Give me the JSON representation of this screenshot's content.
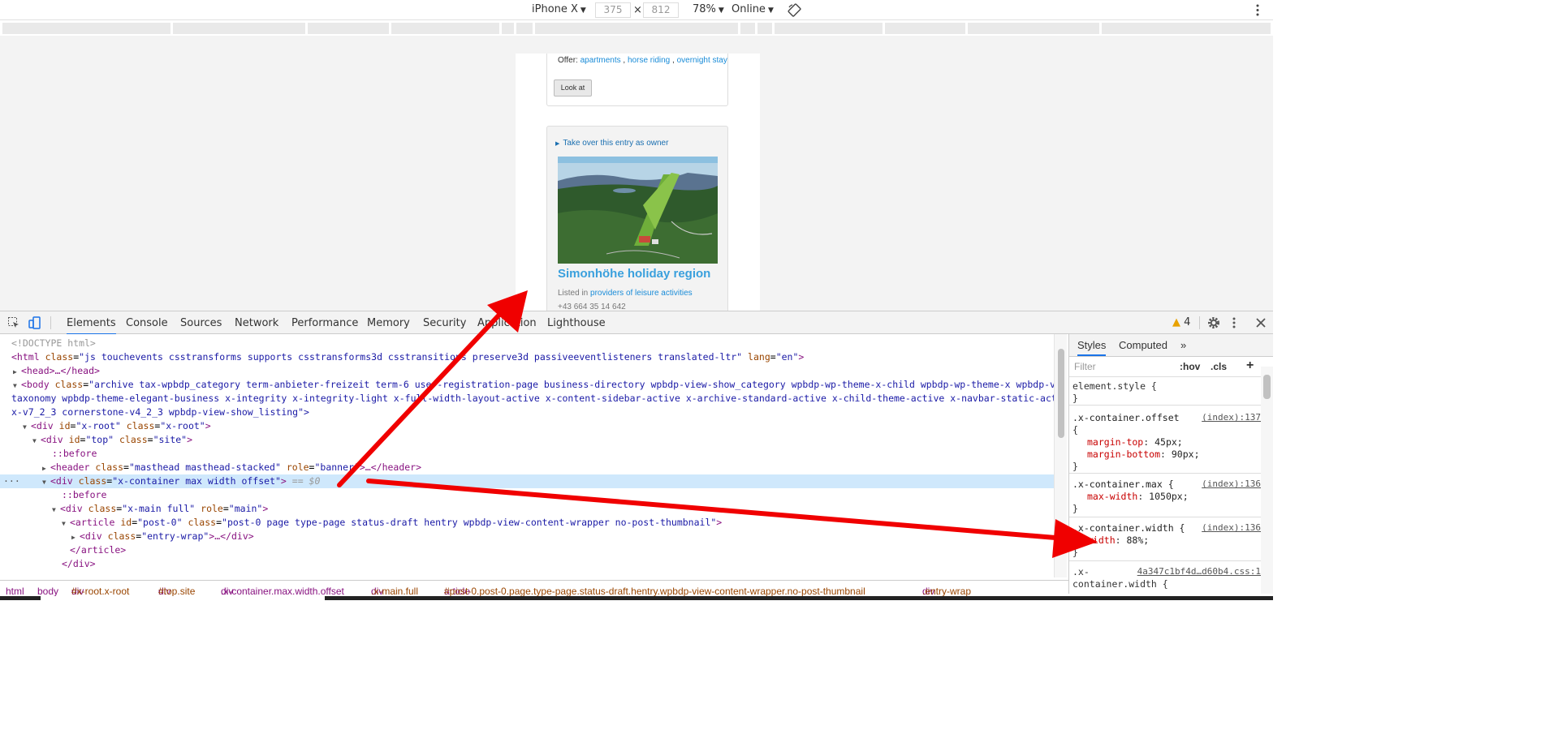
{
  "device_toolbar": {
    "device": "iPhone X",
    "width": "375",
    "times": "×",
    "height": "812",
    "zoom": "78%",
    "network": "Online",
    "rotate_icon": "rotate-icon",
    "more_icon": "vertical-dots-icon"
  },
  "page": {
    "offer_label": "Offer:",
    "offer_links": [
      "apartments",
      "horse riding",
      "overnight stay"
    ],
    "offer_sep": ",",
    "look_at": "Look at",
    "takeover": "Take over this entry as owner",
    "listing_title": "Simonhöhe holiday region",
    "listed_in": "Listed in",
    "listed_link": "providers of leisure activities",
    "phone": "+43 664 35 14 642"
  },
  "devtools": {
    "tabs": [
      "Elements",
      "Console",
      "Sources",
      "Network",
      "Performance",
      "Memory",
      "Security",
      "Application",
      "Lighthouse"
    ],
    "active_tab": "Elements",
    "warnings": "4",
    "styles_tabs": [
      "Styles",
      "Computed"
    ],
    "more_tabs": "»",
    "filter_placeholder": "Filter",
    "hov": ":hov",
    "cls": ".cls",
    "plus": "+"
  },
  "dom": {
    "doctype": "<!DOCTYPE html>",
    "html_tag": "<html",
    "html_class_attr": "class",
    "html_class": "\"js touchevents csstransforms supports csstransforms3d csstransitions preserve3d passiveeventlisteners translated-ltr\"",
    "html_lang_attr": "lang",
    "html_lang": "\"en\"",
    "head": "<head>…</head>",
    "body_tag": "<body",
    "body_class_attr": "class",
    "body_class_1": "\"archive tax-wpbdp_category term-anbieter-freizeit term-6 user-registration-page business-directory wpbdp-view-show_category wpbdp-wp-theme-x-child wpbdp-wp-theme-x wpbdp-view-",
    "body_class_2": "taxonomy wpbdp-theme-elegant-business x-integrity x-integrity-light x-full-width-layout-active x-content-sidebar-active x-archive-standard-active x-child-theme-active x-navbar-static-active",
    "body_class_3": "x-v7_2_3 cornerstone-v4_2_3 wpbdp-view-show_listing\">",
    "xroot_open": "<div",
    "xroot_id": "\"x-root\"",
    "xroot_class": "\"x-root\"",
    "top_id": "\"top\"",
    "top_class": "\"site\"",
    "before": "::before",
    "header_class": "\"masthead masthead-stacked\"",
    "header_role": "\"banner\"",
    "header_rest": ">…</header>",
    "container_class": "\"x-container max width offset\"",
    "eq_dollar": " == $0",
    "main_class": "\"x-main full\"",
    "main_role": "\"main\"",
    "article_id": "\"post-0\"",
    "article_class": "\"post-0 page type-page status-draft hentry wpbdp-view-content-wrapper no-post-thumbnail\"",
    "entry_wrap_class": "\"entry-wrap\"",
    "entry_rest": ">…</div>",
    "article_close": "</article>",
    "div_close": "</div>",
    "dots": "···"
  },
  "styles": {
    "element_style": "element.style {",
    "close": "}",
    "rules": [
      {
        "selector": ".x-container.offset",
        "source": "(index):137",
        "brace": "{",
        "props": [
          {
            "name": "margin-top",
            "value": "45px;"
          },
          {
            "name": "margin-bottom",
            "value": "90px;"
          }
        ]
      },
      {
        "selector": ".x-container.max {",
        "source": "(index):136",
        "props": [
          {
            "name": "max-width",
            "value": "1050px;"
          }
        ]
      },
      {
        "selector": ".x-container.width {",
        "source": "(index):136",
        "props": [
          {
            "name": "width",
            "value": "88%;"
          }
        ]
      }
    ],
    "last_selector_1": ".x-",
    "last_selector_2": "container.width {",
    "last_source": "4a347c1bf4d…d60b4.css:1"
  },
  "breadcrumb": [
    {
      "tag": "html",
      "cls": ""
    },
    {
      "tag": "body",
      "cls": ""
    },
    {
      "tag": "div",
      "cls": "#x-root.x-root"
    },
    {
      "tag": "div",
      "cls": "#top.site"
    },
    {
      "tag": "div",
      "cls": ".x-container.max.width.offset"
    },
    {
      "tag": "div",
      "cls": ".x-main.full"
    },
    {
      "tag": "article",
      "cls": "#post-0.post-0.page.type-page.status-draft.hentry.wpbdp-view-content-wrapper.no-post-thumbnail"
    },
    {
      "tag": "div",
      "cls": ".entry-wrap"
    }
  ],
  "colors": {
    "annotation_arrow": "#f00000",
    "link": "#1a8cd8",
    "title": "#3aa0dd",
    "selected_row": "#cfe8fc"
  }
}
